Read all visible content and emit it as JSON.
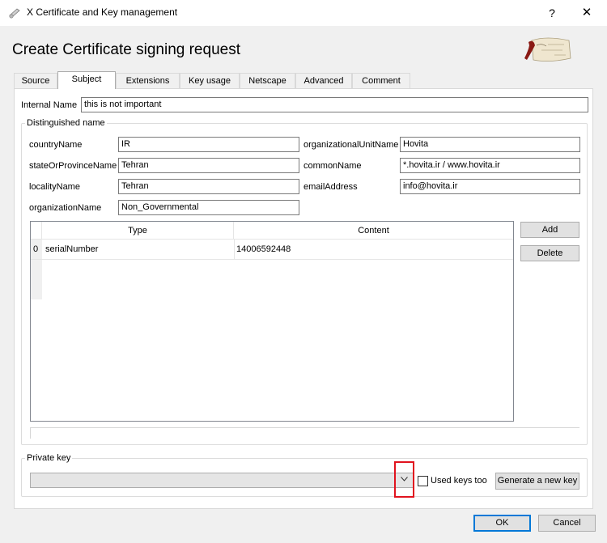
{
  "window": {
    "title": "X Certificate and Key management",
    "help": "?",
    "close": "✕"
  },
  "heading": "Create Certificate signing request",
  "tabs": [
    "Source",
    "Subject",
    "Extensions",
    "Key usage",
    "Netscape",
    "Advanced",
    "Comment"
  ],
  "active_tab": "Subject",
  "internal_name": {
    "label": "Internal Name",
    "value": "this is not important"
  },
  "dn": {
    "title": "Distinguished name",
    "countryName": {
      "label": "countryName",
      "value": "IR"
    },
    "stateOrProvinceName": {
      "label": "stateOrProvinceName",
      "value": "Tehran"
    },
    "localityName": {
      "label": "localityName",
      "value": "Tehran"
    },
    "organizationName": {
      "label": "organizationName",
      "value": "Non_Governmental"
    },
    "organizationalUnitName": {
      "label": "organizationalUnitName",
      "value": "Hovita"
    },
    "commonName": {
      "label": "commonName",
      "value": "*.hovita.ir / www.hovita.ir"
    },
    "emailAddress": {
      "label": "emailAddress",
      "value": "info@hovita.ir"
    }
  },
  "table": {
    "columns": [
      "Type",
      "Content"
    ],
    "rows": [
      {
        "index": "0",
        "type": "serialNumber",
        "content": "14006592448"
      }
    ]
  },
  "buttons": {
    "add": "Add",
    "delete": "Delete",
    "generate": "Generate a new key",
    "ok": "OK",
    "cancel": "Cancel"
  },
  "private_key": {
    "title": "Private key",
    "selected": "",
    "used_keys_label": "Used keys too",
    "used_keys_checked": false
  },
  "icons": {
    "window": "certificate-scroll-icon",
    "logo": "parchment-scroll-logo",
    "dropdown": "chevron-down-icon"
  },
  "colors": {
    "highlight": "#e1131e",
    "accent": "#0078d7"
  }
}
